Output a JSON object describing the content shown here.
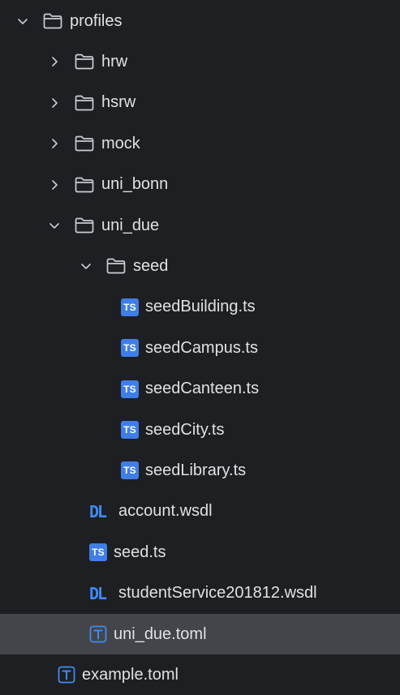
{
  "tree": {
    "items": [
      {
        "label": "profiles",
        "type": "folder",
        "expanded": true,
        "depth": 0,
        "selected": false
      },
      {
        "label": "hrw",
        "type": "folder",
        "expanded": false,
        "depth": 1,
        "selected": false
      },
      {
        "label": "hsrw",
        "type": "folder",
        "expanded": false,
        "depth": 1,
        "selected": false
      },
      {
        "label": "mock",
        "type": "folder",
        "expanded": false,
        "depth": 1,
        "selected": false
      },
      {
        "label": "uni_bonn",
        "type": "folder",
        "expanded": false,
        "depth": 1,
        "selected": false
      },
      {
        "label": "uni_due",
        "type": "folder",
        "expanded": true,
        "depth": 1,
        "selected": false
      },
      {
        "label": "seed",
        "type": "folder",
        "expanded": true,
        "depth": 2,
        "selected": false
      },
      {
        "label": "seedBuilding.ts",
        "type": "ts",
        "depth": 3,
        "selected": false
      },
      {
        "label": "seedCampus.ts",
        "type": "ts",
        "depth": 3,
        "selected": false
      },
      {
        "label": "seedCanteen.ts",
        "type": "ts",
        "depth": 3,
        "selected": false
      },
      {
        "label": "seedCity.ts",
        "type": "ts",
        "depth": 3,
        "selected": false
      },
      {
        "label": "seedLibrary.ts",
        "type": "ts",
        "depth": 3,
        "selected": false
      },
      {
        "label": "account.wsdl",
        "type": "wsdl",
        "depth": 2,
        "selected": false
      },
      {
        "label": "seed.ts",
        "type": "ts",
        "depth": 2,
        "selected": false
      },
      {
        "label": "studentService201812.wsdl",
        "type": "wsdl",
        "depth": 2,
        "selected": false
      },
      {
        "label": "uni_due.toml",
        "type": "toml",
        "depth": 2,
        "selected": true
      },
      {
        "label": "example.toml",
        "type": "toml",
        "depth": 1,
        "selected": false
      }
    ],
    "badges": {
      "ts": "TS",
      "wsdl": "DL",
      "toml": "T"
    },
    "colors": {
      "background": "#1e1f22",
      "selected_row": "#43454a",
      "text": "#dfe1e5",
      "folder_icon": "#c9ccd1",
      "ts_badge": "#3f7ee8",
      "wsdl_badge": "#3f8af2",
      "toml_badge": "#3f8af2"
    }
  }
}
